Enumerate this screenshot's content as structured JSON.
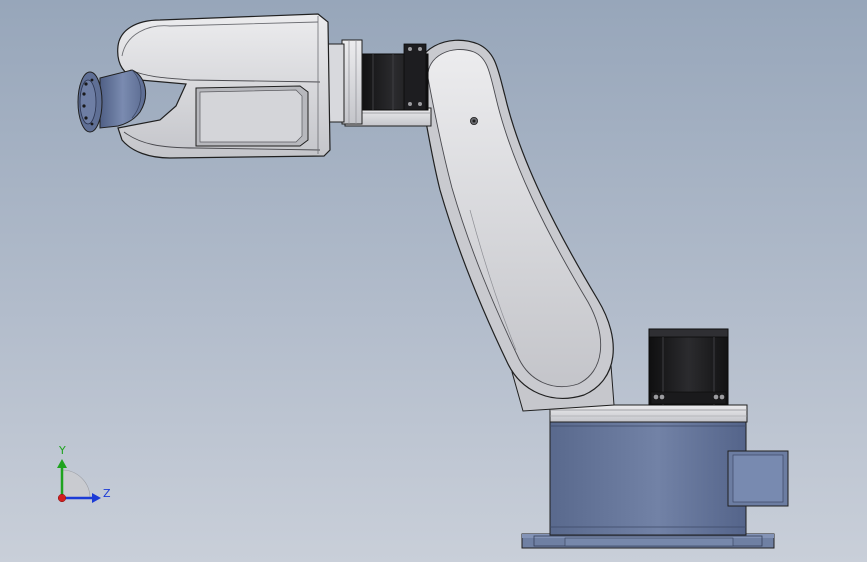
{
  "viewport": {
    "background_top": "#97a6ba",
    "background_bottom": "#c9cfd9"
  },
  "model": {
    "part_colors": {
      "light_gray": "#c8c9ce",
      "blue_gray": "#6d7fa3",
      "motor_black": "#1b1b1d",
      "outline": "#202020"
    }
  },
  "triad": {
    "y_label": "Y",
    "z_label": "Z",
    "y_color": "#1fa31f",
    "z_color": "#1b3bd6",
    "x_color": "#d21e1e"
  }
}
